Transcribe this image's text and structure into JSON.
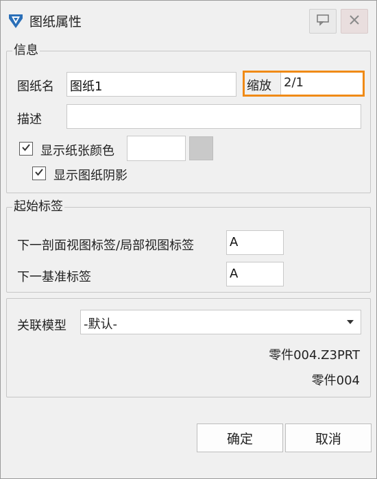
{
  "window": {
    "title": "图纸属性"
  },
  "icons": {
    "app": "app-logo-icon",
    "feedback": "speech-bubble-icon",
    "close": "close-icon",
    "check": "checkmark-icon",
    "dropdown": "chevron-down-icon"
  },
  "info_group": {
    "legend": "信息",
    "drawing_name_label": "图纸名",
    "drawing_name_value": "图纸1",
    "scale_label": "缩放",
    "scale_value": "2/1",
    "description_label": "描述",
    "description_value": "",
    "show_paper_color_label": "显示纸张颜色",
    "show_paper_color_checked": true,
    "show_shadow_label": "显示图纸阴影",
    "show_shadow_checked": true,
    "paper_color": "#ffffff",
    "color_button_color": "#c9c9c9"
  },
  "start_label_group": {
    "legend": "起始标签",
    "next_section_label": "下一剖面视图标签/局部视图标签",
    "next_section_value": "A",
    "next_datum_label": "下一基准标签",
    "next_datum_value": "A"
  },
  "model_group": {
    "linked_model_label": "关联模型",
    "linked_model_value": "-默认-",
    "file_name": "零件004.Z3PRT",
    "part_name": "零件004"
  },
  "buttons": {
    "ok": "确定",
    "cancel": "取消"
  },
  "colors": {
    "highlight": "#f08a16"
  }
}
